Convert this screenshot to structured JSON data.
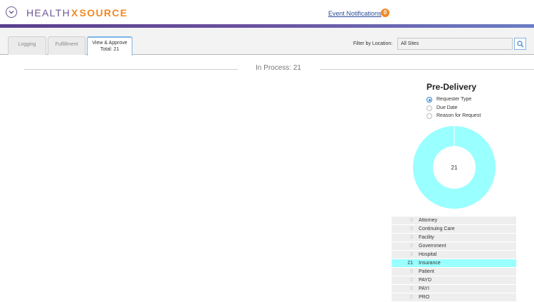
{
  "header": {
    "logo_health": "HEALTH",
    "logo_x": "X",
    "logo_source": "SOURCE",
    "events_label": "Event Notifications",
    "events_count": "0"
  },
  "tabs": [
    {
      "label": "Logging"
    },
    {
      "label": "Fulfillment"
    },
    {
      "label": "View & Approve",
      "sub": "Total: 21"
    }
  ],
  "filter": {
    "label": "Filter by Location:",
    "value": "All Sites"
  },
  "main": {
    "in_process": "In Process: 21"
  },
  "panel": {
    "title": "Pre-Delivery",
    "radios": [
      {
        "label": "Requester Type",
        "checked": true
      },
      {
        "label": "Due Date",
        "checked": false
      },
      {
        "label": "Reason for Request",
        "checked": false
      }
    ],
    "donut_center": "21"
  },
  "chart_data": {
    "type": "pie",
    "title": "Pre-Delivery",
    "categories": [
      "Attorney",
      "Continuing Care",
      "Facility",
      "Government",
      "Hospital",
      "Insurance",
      "Patient",
      "PAYD",
      "PAYI",
      "PRO"
    ],
    "values": [
      0,
      0,
      0,
      0,
      0,
      21,
      0,
      0,
      0,
      0
    ],
    "highlight_color": "#99ffff"
  },
  "colors": {
    "accent_orange": "#f08a24",
    "brand_purple": "#6d5a96",
    "donut_fill": "#99ffff"
  }
}
